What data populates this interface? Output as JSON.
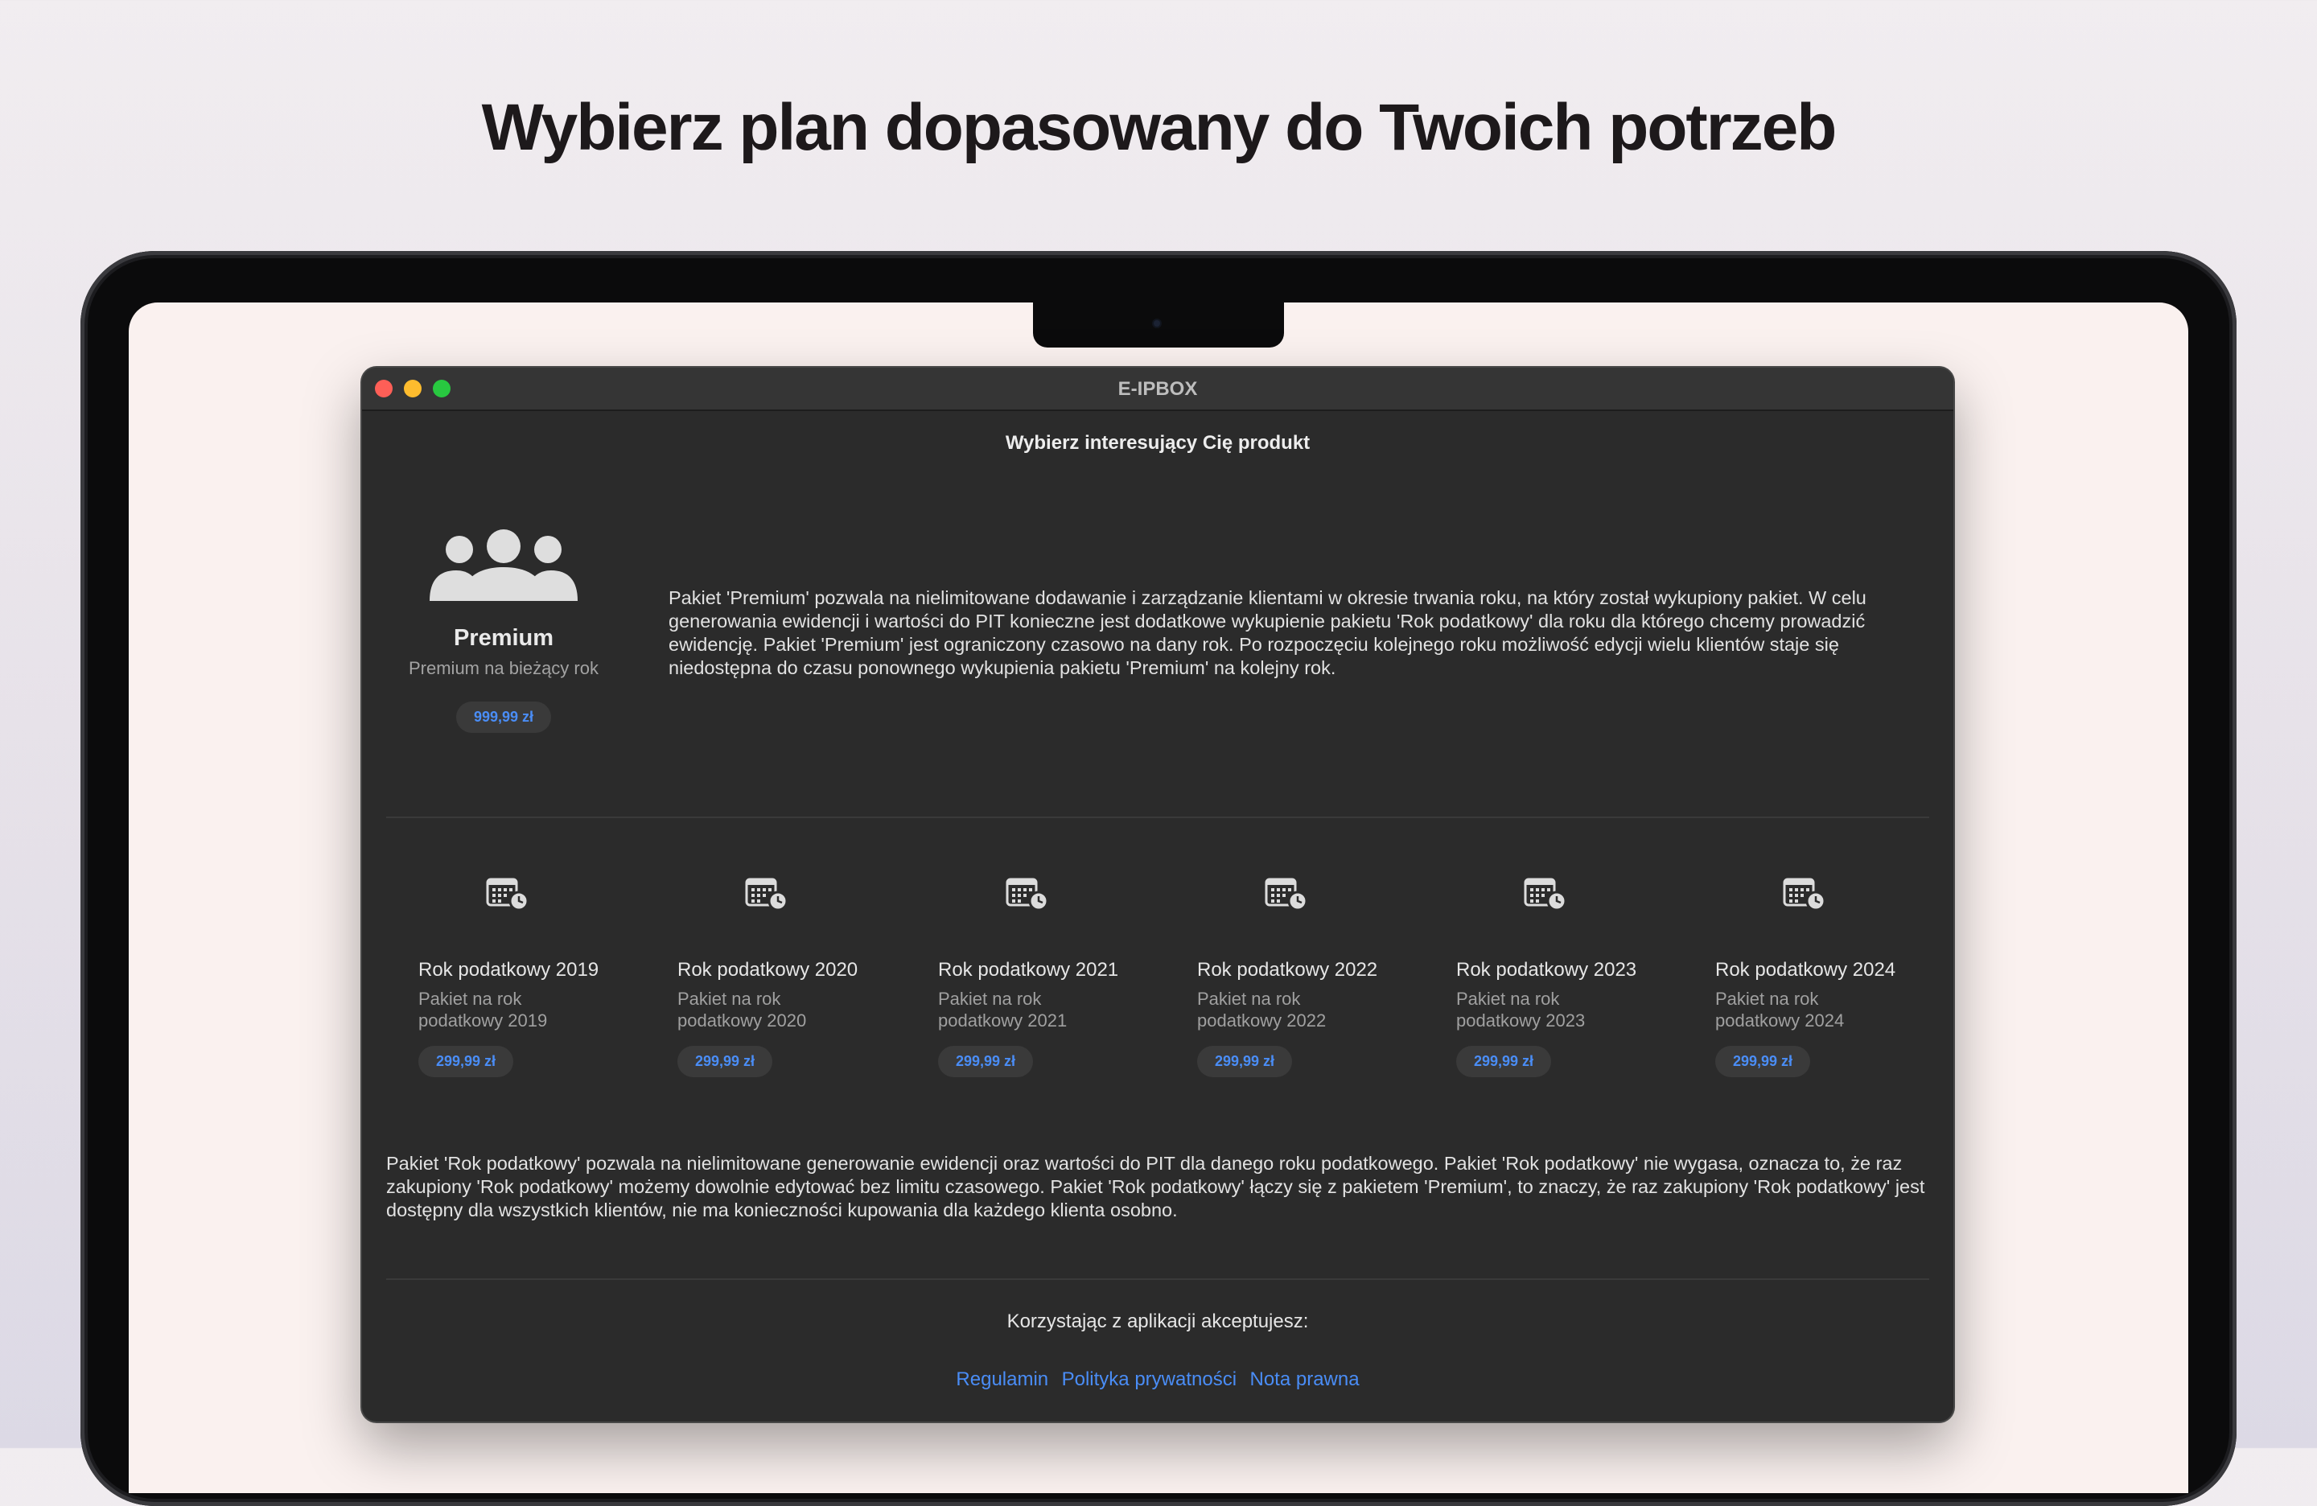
{
  "page": {
    "headline": "Wybierz plan dopasowany do Twoich potrzeb"
  },
  "window": {
    "title": "E-IPBOX",
    "subtitle": "Wybierz interesujący Cię produkt"
  },
  "premium": {
    "icon": "people-group-icon",
    "name": "Premium",
    "description": "Premium na bieżący rok",
    "price": "999,99 zł",
    "text": "Pakiet 'Premium' pozwala na nielimitowane dodawanie i zarządzanie klientami w okresie trwania roku, na który został wykupiony pakiet. W celu generowania ewidencji i wartości do PIT konieczne jest dodatkowe wykupienie pakietu 'Rok podatkowy' dla roku dla którego chcemy prowadzić ewidencję. Pakiet 'Premium' jest ograniczony czasowo na dany rok. Po rozpoczęciu kolejnego roku możliwość edycji wielu klientów staje się niedostępna do czasu ponownego wykupienia pakietu 'Premium' na kolejny rok."
  },
  "tax_years": [
    {
      "name": "Rok podatkowy 2019",
      "description": "Pakiet na rok podatkowy 2019",
      "price": "299,99 zł",
      "icon": "calendar-clock-icon"
    },
    {
      "name": "Rok podatkowy 2020",
      "description": "Pakiet na rok podatkowy 2020",
      "price": "299,99 zł",
      "icon": "calendar-clock-icon"
    },
    {
      "name": "Rok podatkowy 2021",
      "description": "Pakiet na rok podatkowy 2021",
      "price": "299,99 zł",
      "icon": "calendar-clock-icon"
    },
    {
      "name": "Rok podatkowy 2022",
      "description": "Pakiet na rok podatkowy 2022",
      "price": "299,99 zł",
      "icon": "calendar-clock-icon"
    },
    {
      "name": "Rok podatkowy 2023",
      "description": "Pakiet na rok podatkowy 2023",
      "price": "299,99 zł",
      "icon": "calendar-clock-icon"
    },
    {
      "name": "Rok podatkowy 2024",
      "description": "Pakiet na rok podatkowy 2024",
      "price": "299,99 zł",
      "icon": "calendar-clock-icon"
    }
  ],
  "tax_year_text": "Pakiet 'Rok podatkowy' pozwala na nielimitowane generowanie ewidencji oraz wartości do PIT dla danego roku podatkowego. Pakiet 'Rok podatkowy' nie wygasa, oznacza to, że raz zakupiony 'Rok podatkowy' możemy dowolnie edytować bez limitu czasowego. Pakiet 'Rok podatkowy' łączy się z pakietem 'Premium', to znaczy, że raz zakupiony 'Rok podatkowy' jest dostępny dla wszystkich klientów, nie ma konieczności kupowania dla każdego klienta osobno.",
  "footer": {
    "accept_text": "Korzystając z aplikacji akceptujesz:",
    "links": [
      "Regulamin",
      "Polityka prywatności",
      "Nota prawna"
    ]
  },
  "colors": {
    "accent": "#4a8df6",
    "window_bg": "#2b2b2b",
    "screen_bg": "#faf1ef"
  }
}
